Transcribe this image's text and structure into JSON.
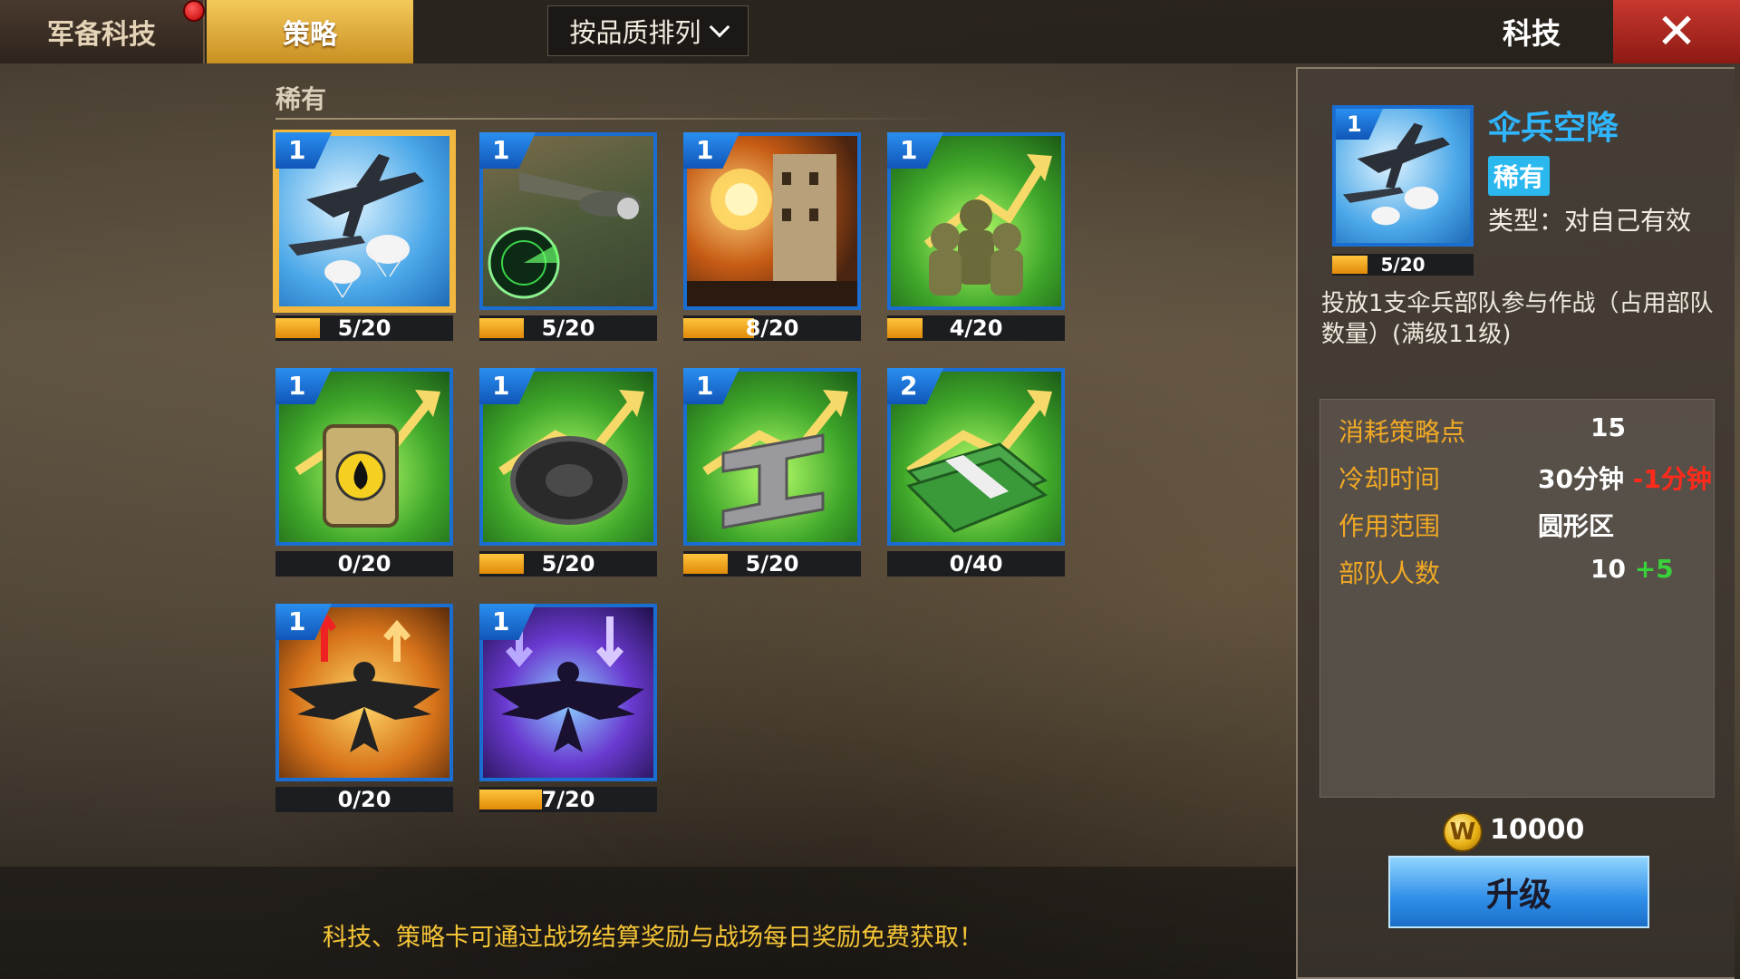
{
  "tabs": [
    {
      "label": "军备科技",
      "active": false,
      "has_notification": true
    },
    {
      "label": "策略",
      "active": true
    }
  ],
  "sort": {
    "label": "按品质排列"
  },
  "panel_title": "科技",
  "section": {
    "label": "稀有"
  },
  "cards": [
    {
      "level": "1",
      "progress": "5/20",
      "icon": "paratrooper-plane-icon",
      "selected": true,
      "fill": 0.25
    },
    {
      "level": "1",
      "progress": "5/20",
      "icon": "recon-plane-radar-icon",
      "fill": 0.25
    },
    {
      "level": "1",
      "progress": "8/20",
      "icon": "tower-explosion-icon",
      "fill": 0.4
    },
    {
      "level": "1",
      "progress": "4/20",
      "icon": "soldiers-growth-icon",
      "fill": 0.2
    },
    {
      "level": "1",
      "progress": "0/20",
      "icon": "oil-barrel-growth-icon",
      "fill": 0
    },
    {
      "level": "1",
      "progress": "5/20",
      "icon": "tire-growth-icon",
      "fill": 0.25
    },
    {
      "level": "1",
      "progress": "5/20",
      "icon": "steel-beam-growth-icon",
      "fill": 0.25
    },
    {
      "level": "2",
      "progress": "0/40",
      "icon": "cash-growth-icon",
      "fill": 0
    },
    {
      "level": "1",
      "progress": "0/20",
      "icon": "eagle-boost-up-icon",
      "fill": 0
    },
    {
      "level": "1",
      "progress": "7/20",
      "icon": "eagle-reduce-down-icon",
      "fill": 0.35
    }
  ],
  "detail": {
    "level": "1",
    "progress": "5/20",
    "fill": 0.25,
    "name": "伞兵空降",
    "rarity": "稀有",
    "type": "类型：对自己有效",
    "description": "投放1支伞兵部队参与作战（占用部队数量）(满级11级)",
    "stats": [
      {
        "key": "消耗策略点",
        "value": "15",
        "delta": "",
        "delta_color": ""
      },
      {
        "key": "冷却时间",
        "value": "30分钟",
        "delta": "-1分钟",
        "delta_color": "red"
      },
      {
        "key": "作用范围",
        "value": "圆形区",
        "delta": "",
        "delta_color": ""
      },
      {
        "key": "部队人数",
        "value": "10",
        "delta": "+5",
        "delta_color": "green"
      }
    ],
    "cost": "10000",
    "coin_letter": "W",
    "upgrade_label": "升级"
  },
  "tip": "科技、策略卡可通过战场结算奖励与战场每日奖励免费获取！",
  "colors": {
    "accent_gold": "#f1b73e",
    "card_border": "#1b6ed1",
    "stat_key": "#f0a825",
    "name_blue": "#2fb6ff"
  }
}
